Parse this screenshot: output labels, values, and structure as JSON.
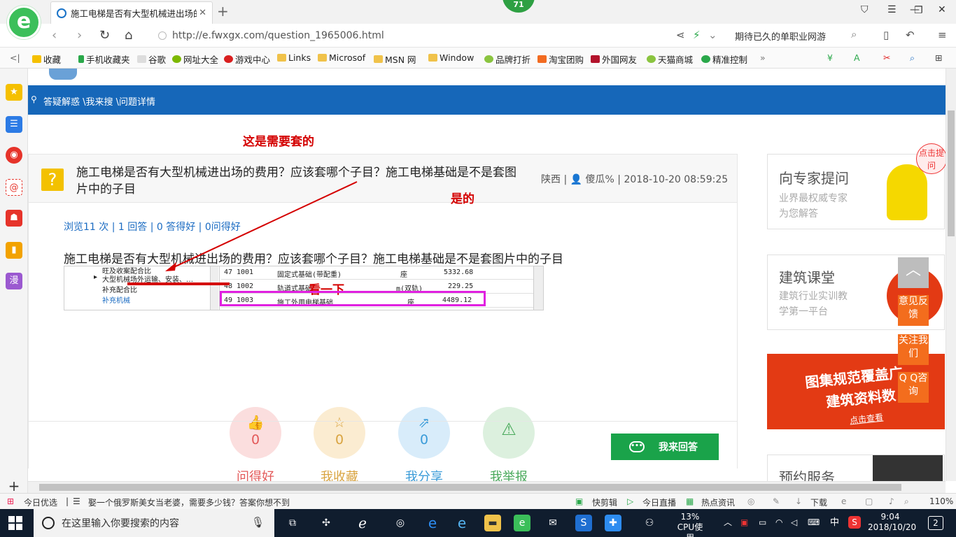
{
  "browser": {
    "tab_title": "施工电梯是否有大型机械进出场的",
    "badge": "71",
    "url": "http://e.fwxgx.com/question_1965006.html",
    "search_placeholder": "期待已久的单职业网游",
    "bookmarks": [
      "收藏",
      "手机收藏夹",
      "谷歌",
      "网址大全",
      "游戏中心",
      "Links",
      "Microsof",
      "MSN 网",
      "Window",
      "品牌打折",
      "淘宝团购",
      "外国网友",
      "天猫商城",
      "精准控制"
    ]
  },
  "page": {
    "breadcrumb": "答疑解惑 \\我来搜 \\问题详情",
    "annotations": {
      "need": "这是需要套的",
      "yes": "是的",
      "look": "看一下"
    },
    "question": {
      "title": "施工电梯是否有大型机械进出场的费用？应该套哪个子目？施工电梯基础是不是套图片中的子目",
      "location": "陕西",
      "user": "傻瓜%",
      "date": "2018-10-20 08:59:25",
      "stats": "浏览11 次 | 1 回答 | 0 答得好 | 0问得好",
      "body": "施工电梯是否有大型机械进出场的费用？应该套哪个子目？施工电梯基础是不是套图片中的子目"
    },
    "screenshot": {
      "tree": [
        "旺及收案配合比",
        "大型机械场外运输、安装、…",
        "补充配合比",
        "补充机械"
      ],
      "rows": [
        {
          "no": "47",
          "code": "1001",
          "name": "固定式基础(带配重)",
          "unit": "座",
          "price": "5332.68"
        },
        {
          "no": "48",
          "code": "1002",
          "name": "轨道式基础",
          "unit": "m(双轨)",
          "price": "229.25"
        },
        {
          "no": "49",
          "code": "1003",
          "name": "施工外用电梯基础",
          "unit": "座",
          "price": "4489.12"
        }
      ]
    },
    "actions": [
      {
        "label": "问得好",
        "count": "0",
        "color": "#e35a5a",
        "bg": "#fbdede"
      },
      {
        "label": "我收藏",
        "count": "0",
        "color": "#d9a441",
        "bg": "#fbecd1"
      },
      {
        "label": "我分享",
        "count": "0",
        "color": "#3a9bd8",
        "bg": "#d8ecfa"
      },
      {
        "label": "我举报",
        "count": "",
        "color": "#49a95b",
        "bg": "#dcf0de"
      }
    ],
    "answer_button": "我来回答",
    "right": {
      "expert_title": "向专家提问",
      "expert_sub1": "业界最权威专家",
      "expert_sub2": "为您解答",
      "bubble": "点击提问",
      "course_title": "建筑课堂",
      "course_sub1": "建筑行业实训教",
      "course_sub2": "学第一平台",
      "banner1": "图集规范覆盖广",
      "banner2": "建筑资料数",
      "banner3": "点击查看",
      "booking": "预约服务",
      "float_feedback": "意见反馈",
      "float_follow": "关注我们",
      "float_qq": "Q Q咨询"
    }
  },
  "statusbar": {
    "left": "今日优选",
    "news": "娶一个俄罗斯美女当老婆，需要多少钱？答案你想不到",
    "items": [
      "快剪辑",
      "今日直播",
      "热点资讯",
      "下载"
    ],
    "zoom": "110%"
  },
  "taskbar": {
    "search": "在这里输入你要搜索的内容",
    "cpu": "13%",
    "cpu_label": "CPU使用",
    "ime": "中",
    "time": "9:04",
    "date": "2018/10/20",
    "notifications": "2"
  }
}
